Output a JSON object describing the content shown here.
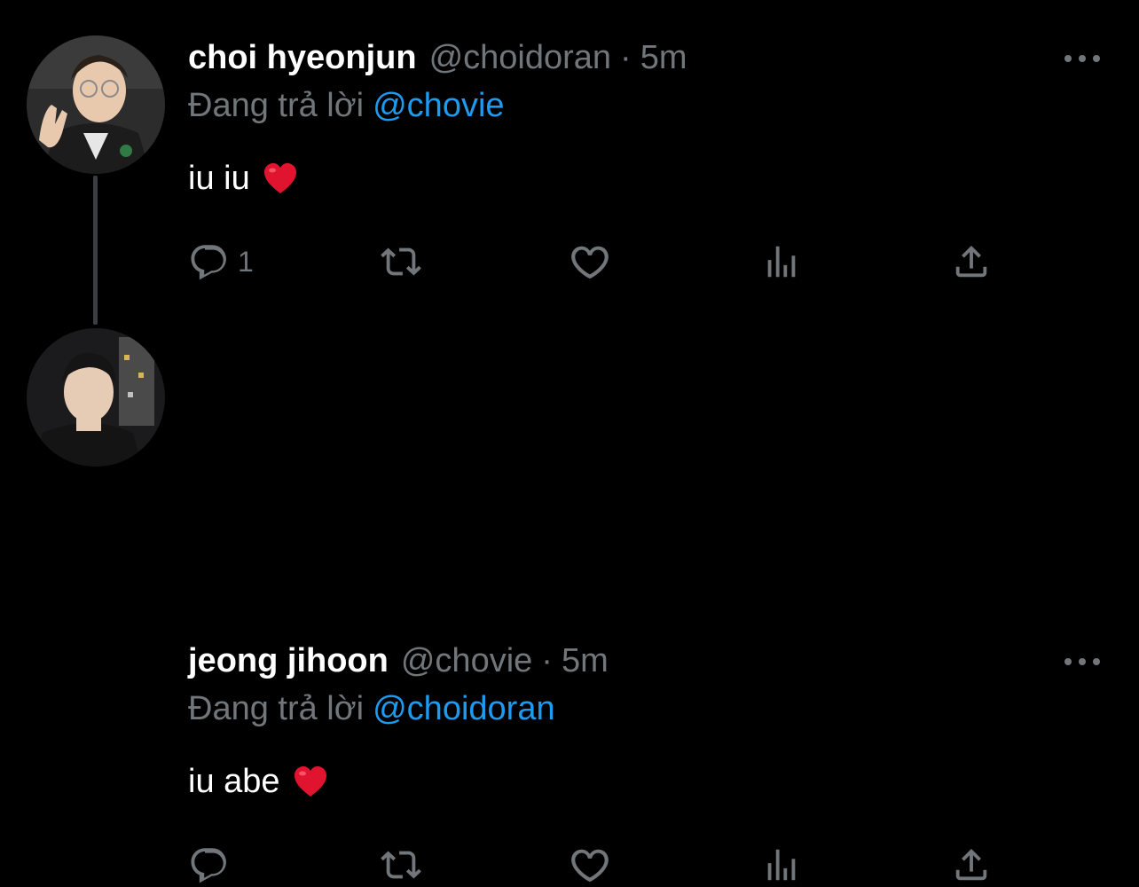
{
  "theme": {
    "background": "#000000",
    "text": "#ffffff",
    "muted": "#71767b",
    "accent": "#1d9bf0",
    "thread_line": "#3a3d41"
  },
  "tweets": [
    {
      "display_name": "choi hyeonjun",
      "handle": "@choidoran",
      "separator": "·",
      "time": "5m",
      "reply_prefix": "Đang trả lời",
      "reply_to": "@chovie",
      "text": "iu iu",
      "emoji": "red-heart",
      "reply_count": "1",
      "icons": [
        "reply-icon",
        "retweet-icon",
        "like-icon",
        "views-icon",
        "share-icon",
        "more-icon"
      ]
    },
    {
      "display_name": "jeong jihoon",
      "handle": "@chovie",
      "separator": "·",
      "time": "5m",
      "reply_prefix": "Đang trả lời",
      "reply_to": "@choidoran",
      "text": "iu abe",
      "emoji": "red-heart",
      "reply_count": "",
      "icons": [
        "reply-icon",
        "retweet-icon",
        "like-icon",
        "views-icon",
        "share-icon",
        "more-icon"
      ]
    }
  ]
}
